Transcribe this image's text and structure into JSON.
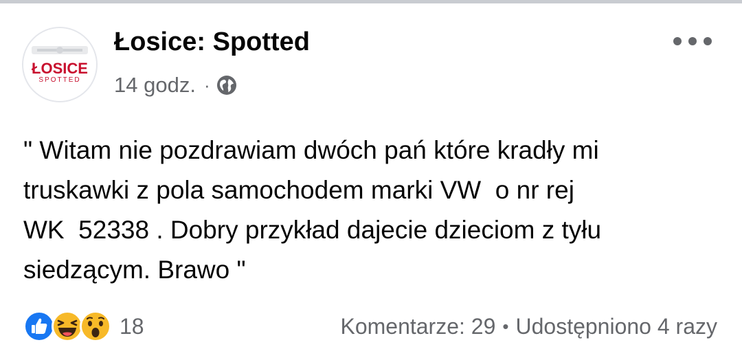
{
  "post": {
    "page_name": "Łosice: Spotted",
    "timestamp": "14 godz.",
    "separator": "·",
    "privacy_icon": "globe-icon",
    "more_icon": "more-options-icon",
    "avatar": {
      "logo_text": "ŁOSICE",
      "logo_subtext": "SPOTTED"
    },
    "text": "\" Witam nie pozdrawiam dwóch pań które kradły mi\ntruskawki z pola samochodem marki VW  o nr rej\nWK  52338 . Dobry przykład dajecie dzieciom z tyłu\nsiedzącym. Brawo \""
  },
  "footer": {
    "reactions": [
      "like-icon",
      "haha-icon",
      "wow-icon"
    ],
    "reaction_count": "18",
    "comments": "Komentarze: 29",
    "dot": "•",
    "shares": "Udostępniono 4 razy"
  },
  "colors": {
    "text_primary": "#050505",
    "text_secondary": "#65676b",
    "like_blue": "#1877f2",
    "emoji_yellow": "#f7b928",
    "logo_red": "#c8102e"
  }
}
